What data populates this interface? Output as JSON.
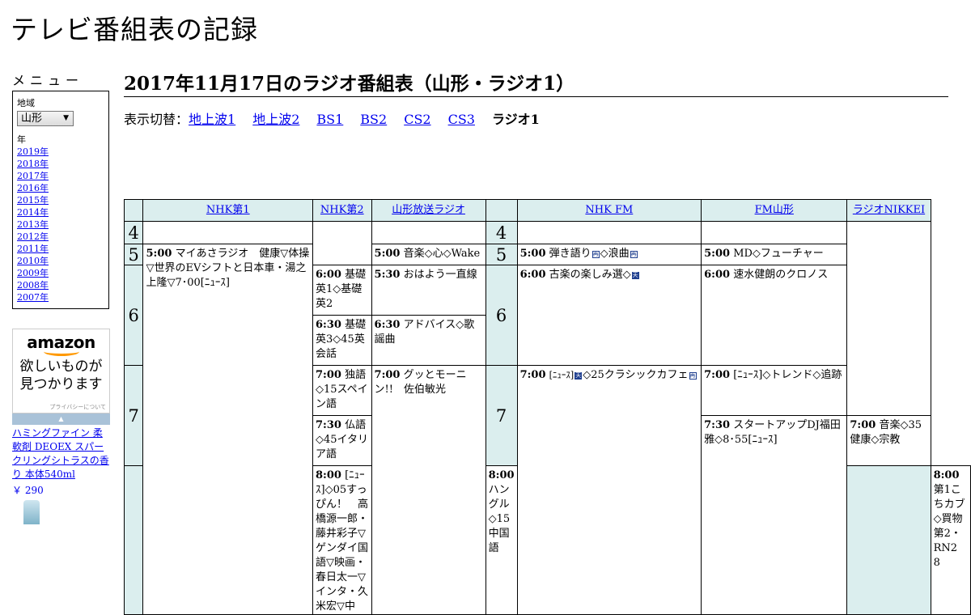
{
  "site_title": "テレビ番組表の記録",
  "sidebar": {
    "menu_label": "メニュー",
    "region_label": "地域",
    "region_value": "山形",
    "year_label": "年",
    "years": [
      "2019年",
      "2018年",
      "2017年",
      "2016年",
      "2015年",
      "2014年",
      "2013年",
      "2012年",
      "2011年",
      "2010年",
      "2009年",
      "2008年",
      "2007年"
    ]
  },
  "ad": {
    "logo": "amazon",
    "copy_line1": "欲しいものが",
    "copy_line2": "見つかります",
    "privacy": "プライバシーについて",
    "product": "ハミングファイン 柔軟剤 DEOEX スパークリングシトラスの香り 本体540ml",
    "price": "￥ 290"
  },
  "main": {
    "heading": "2017年11月17日のラジオ番組表（山形・ラジオ1）",
    "switch_label": "表示切替：",
    "tabs": [
      "地上波1",
      "地上波2",
      "BS1",
      "BS2",
      "CS2",
      "CS3"
    ],
    "current_tab": "ラジオ1"
  },
  "channels": [
    "NHK第1",
    "NHK第2",
    "山形放送ラジオ",
    "NHK FM",
    "FM山形",
    "ラジオNIKKEI"
  ],
  "hours": [
    "4",
    "5",
    "6",
    "7",
    "4",
    "5",
    "6",
    "7"
  ],
  "programs": {
    "nhk1_500_time": "5:00",
    "nhk1_500": "マイあさラジオ　健康▽体操▽世界のEVシフトと日本車・湯之上隆▽7･00[ﾆｭｰｽ]",
    "nhk1_800_time": "8:00",
    "nhk1_800": "[ﾆｭｰｽ]◇05すっぴん！　高橋源一郎・藤井彩子▽ゲンダイ国語▽映画・春日太一▽インタ・久米宏▽中",
    "nhk2_600_time": "6:00",
    "nhk2_600": "基礎英1◇基礎英2",
    "nhk2_630_time": "6:30",
    "nhk2_630": "基礎英3◇45英会話",
    "nhk2_700_time": "7:00",
    "nhk2_700": "独語◇15スペイン語",
    "nhk2_730_time": "7:30",
    "nhk2_730": "仏語◇45イタリア語",
    "nhk2_800_time": "8:00",
    "nhk2_800": "ハングル◇15中国語",
    "ybc_500_time": "5:00",
    "ybc_500": "音楽◇心◇Wake",
    "ybc_530_time": "5:30",
    "ybc_530": "おはよう一直線",
    "ybc_630_time": "6:30",
    "ybc_630": "アドバイス◇歌謡曲",
    "ybc_700_time": "7:00",
    "ybc_700": "グッとモーニン!!　佐伯敏光",
    "fm_500_time": "5:00",
    "fm_500_a": "弾き語り",
    "fm_500_b": "◇浪曲",
    "fm_600_time": "6:00",
    "fm_600": "古楽の楽しみ選◇",
    "fm_700_time": "7:00",
    "fm_700_a": "[ﾆｭｰｽ]",
    "fm_700_b": "◇25クラシックカフェ",
    "fmy_500_time": "5:00",
    "fmy_500": "MD◇フューチャー",
    "fmy_600_time": "6:00",
    "fmy_600": "速水健朗のクロノス",
    "fmy_700_time": "7:00",
    "fmy_700": "[ﾆｭｰｽ]◇トレンド◇追跡",
    "fmy_730_time": "7:30",
    "fmy_730": "スタートアップDJ福田雅◇8･55[ﾆｭｰｽ]",
    "nikkei_700_time": "7:00",
    "nikkei_700": "音楽◇35健康◇宗教",
    "nikkei_800_time": "8:00",
    "nikkei_800": "第1こちカブ◇買物第2・RN2　8"
  },
  "marks": {
    "re": "再",
    "ten": "天"
  }
}
